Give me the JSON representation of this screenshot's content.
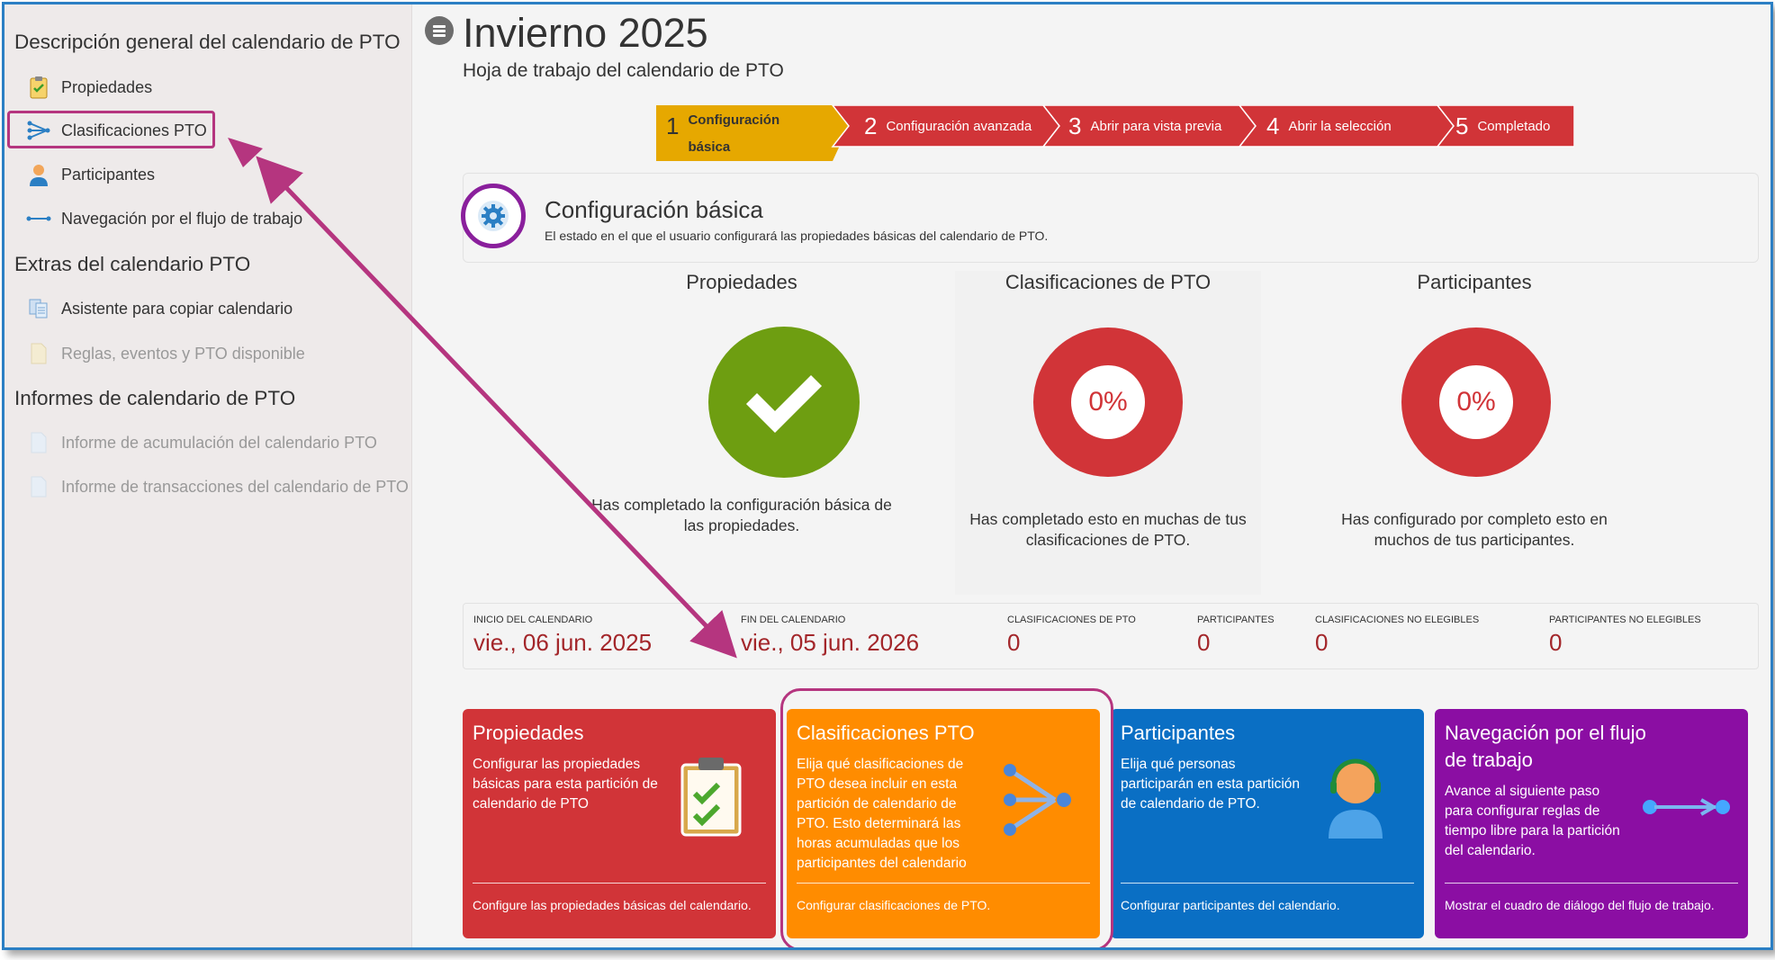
{
  "sidebar": {
    "sections": [
      {
        "heading": "Descripción general del calendario de PTO"
      },
      {
        "heading": "Extras del calendario PTO"
      },
      {
        "heading": "Informes de calendario de PTO"
      }
    ],
    "items": [
      {
        "label": "Propiedades",
        "icon": "clipboard-check-icon"
      },
      {
        "label": "Clasificaciones PTO",
        "icon": "branch-arrow-icon"
      },
      {
        "label": "Participantes",
        "icon": "person-icon"
      },
      {
        "label": "Navegación por el flujo de trabajo",
        "icon": "workflow-arrow-icon"
      },
      {
        "label": "Asistente para copiar calendario",
        "icon": "copy-calendar-icon"
      },
      {
        "label": "Reglas, eventos y PTO disponible",
        "icon": "document-icon"
      },
      {
        "label": "Informe de acumulación del calendario PTO",
        "icon": "report-icon"
      },
      {
        "label": "Informe de transacciones del calendario de PTO",
        "icon": "report-icon"
      }
    ]
  },
  "header": {
    "title": "Invierno 2025",
    "subtitle": "Hoja de trabajo del calendario de PTO"
  },
  "steps": [
    {
      "num": "1",
      "label": "Configuración básica",
      "color": "#e6a800"
    },
    {
      "num": "2",
      "label": "Configuración avanzada",
      "color": "#d13438"
    },
    {
      "num": "3",
      "label": "Abrir para vista previa",
      "color": "#d13438"
    },
    {
      "num": "4",
      "label": "Abrir la selección",
      "color": "#d13438"
    },
    {
      "num": "5",
      "label": "Completado",
      "color": "#d13438"
    }
  ],
  "config": {
    "title": "Configuración básica",
    "description": "El estado en el que el usuario configurará las propiedades básicas del calendario de PTO."
  },
  "stats": [
    {
      "title": "Propiedades",
      "desc": "Has completado la configuración básica de las propiedades.",
      "status": "complete"
    },
    {
      "title": "Clasificaciones de PTO",
      "percent": "0%",
      "desc": "Has completado esto en muchas de tus clasificaciones de PTO."
    },
    {
      "title": "Participantes",
      "percent": "0%",
      "desc": "Has configurado por completo esto en muchos de tus participantes."
    }
  ],
  "summary": [
    {
      "label": "INICIO DEL CALENDARIO",
      "value": "vie., 06 jun. 2025"
    },
    {
      "label": "FIN DEL CALENDARIO",
      "value": "vie., 05 jun. 2026"
    },
    {
      "label": "CLASIFICACIONES DE PTO",
      "value": "0"
    },
    {
      "label": "PARTICIPANTES",
      "value": "0"
    },
    {
      "label": "CLASIFICACIONES NO ELEGIBLES",
      "value": "0"
    },
    {
      "label": "PARTICIPANTES NO ELEGIBLES",
      "value": "0"
    }
  ],
  "tiles": [
    {
      "title": "Propiedades",
      "desc": "Configurar las propiedades básicas para esta partición de calendario de PTO",
      "footer": "Configure las propiedades básicas del calendario.",
      "color": "#d13438"
    },
    {
      "title": "Clasificaciones PTO",
      "desc": "Elija qué clasificaciones de PTO desea incluir en esta partición de calendario de PTO. Esto determinará las horas acumuladas que los participantes del calendario",
      "footer": "Configurar clasificaciones de PTO.",
      "color": "#ff8c00"
    },
    {
      "title": "Participantes",
      "desc": "Elija qué personas participarán en esta partición de calendario de PTO.",
      "footer": "Configurar participantes del calendario.",
      "color": "#0a6fc4"
    },
    {
      "title": "Navegación por el flujo de trabajo",
      "desc": "Avance al siguiente paso para configurar reglas de tiempo libre para la partición del calendario.",
      "footer": "Mostrar el cuadro de diálogo del flujo de trabajo.",
      "color": "#8b0ea3"
    }
  ],
  "annotation_color": "#b5357f"
}
